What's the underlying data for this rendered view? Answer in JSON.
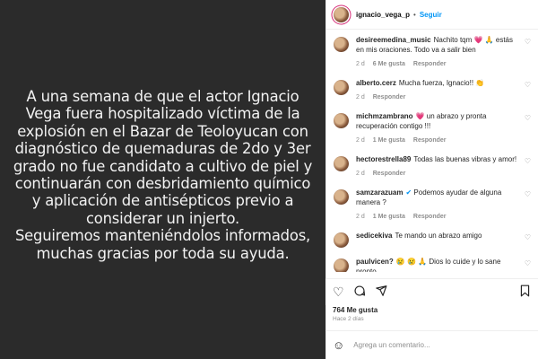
{
  "post_image": {
    "text": "A una semana de que el actor Ignacio Vega fuera hospitalizado víctima de la explosión en el Bazar de Teoloyucan con diagnóstico de quemaduras de 2do y 3er grado no fue candidato a cultivo de piel y continuarán con desbridamiento químico y aplicación de antisépticos previo a considerar un injerto.\nSeguiremos manteniéndolos informados, muchas gracias por toda su ayuda."
  },
  "header": {
    "username": "ignacio_vega_p",
    "separator": "•",
    "follow_label": "Seguir"
  },
  "comments": [
    {
      "user": "desireemedina_music",
      "text": "Nachito tqm 💗 🙏 estás en mis oraciones. Todo va a salir bien",
      "age": "2 d",
      "likes": "6 Me gusta",
      "reply": "Responder"
    },
    {
      "user": "alberto.cerz",
      "text": "Mucha fuerza, Ignacio!! 👏",
      "age": "2 d",
      "likes": "",
      "reply": "Responder"
    },
    {
      "user": "michmzambrano",
      "text": "💗 un abrazo y pronta recuperación contigo !!!",
      "age": "2 d",
      "likes": "1 Me gusta",
      "reply": "Responder"
    },
    {
      "user": "hectorestrella89",
      "text": "Todas las buenas vibras y amor!",
      "age": "2 d",
      "likes": "",
      "reply": "Responder"
    },
    {
      "user": "samzarazuam",
      "text": "Podemos ayudar de alguna manera ?",
      "age": "2 d",
      "likes": "1 Me gusta",
      "reply": "Responder",
      "verified": true
    },
    {
      "user": "sedicekiva",
      "text": "Te mando un abrazo amigo",
      "age": "",
      "likes": "",
      "reply": ""
    },
    {
      "user": "paulvicen?",
      "text": "😢 😢 🙏 Dios lo cuide y lo sane pronto",
      "age": "",
      "likes": "",
      "reply": ""
    }
  ],
  "actions": {
    "like_icon": "heart-icon",
    "comment_icon": "comment-icon",
    "share_icon": "share-icon",
    "save_icon": "bookmark-icon"
  },
  "likes_count": "764 Me gusta",
  "posted_ago": "Hace 2 días",
  "add_comment": {
    "placeholder": "Agrega un comentario..."
  },
  "colors": {
    "accent": "#0095f6",
    "image_bg": "#2b2b2b",
    "image_text": "#f2f2f2"
  }
}
